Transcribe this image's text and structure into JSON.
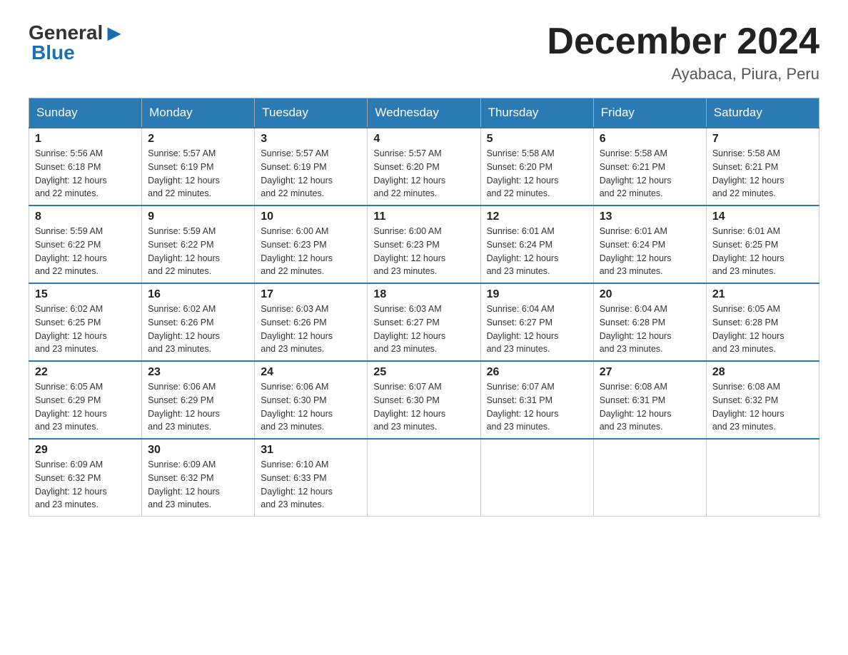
{
  "header": {
    "logo_general": "General",
    "logo_blue": "Blue",
    "title": "December 2024",
    "subtitle": "Ayabaca, Piura, Peru"
  },
  "days_of_week": [
    "Sunday",
    "Monday",
    "Tuesday",
    "Wednesday",
    "Thursday",
    "Friday",
    "Saturday"
  ],
  "weeks": [
    [
      {
        "day": "1",
        "sunrise": "5:56 AM",
        "sunset": "6:18 PM",
        "daylight": "12 hours and 22 minutes."
      },
      {
        "day": "2",
        "sunrise": "5:57 AM",
        "sunset": "6:19 PM",
        "daylight": "12 hours and 22 minutes."
      },
      {
        "day": "3",
        "sunrise": "5:57 AM",
        "sunset": "6:19 PM",
        "daylight": "12 hours and 22 minutes."
      },
      {
        "day": "4",
        "sunrise": "5:57 AM",
        "sunset": "6:20 PM",
        "daylight": "12 hours and 22 minutes."
      },
      {
        "day": "5",
        "sunrise": "5:58 AM",
        "sunset": "6:20 PM",
        "daylight": "12 hours and 22 minutes."
      },
      {
        "day": "6",
        "sunrise": "5:58 AM",
        "sunset": "6:21 PM",
        "daylight": "12 hours and 22 minutes."
      },
      {
        "day": "7",
        "sunrise": "5:58 AM",
        "sunset": "6:21 PM",
        "daylight": "12 hours and 22 minutes."
      }
    ],
    [
      {
        "day": "8",
        "sunrise": "5:59 AM",
        "sunset": "6:22 PM",
        "daylight": "12 hours and 22 minutes."
      },
      {
        "day": "9",
        "sunrise": "5:59 AM",
        "sunset": "6:22 PM",
        "daylight": "12 hours and 22 minutes."
      },
      {
        "day": "10",
        "sunrise": "6:00 AM",
        "sunset": "6:23 PM",
        "daylight": "12 hours and 22 minutes."
      },
      {
        "day": "11",
        "sunrise": "6:00 AM",
        "sunset": "6:23 PM",
        "daylight": "12 hours and 23 minutes."
      },
      {
        "day": "12",
        "sunrise": "6:01 AM",
        "sunset": "6:24 PM",
        "daylight": "12 hours and 23 minutes."
      },
      {
        "day": "13",
        "sunrise": "6:01 AM",
        "sunset": "6:24 PM",
        "daylight": "12 hours and 23 minutes."
      },
      {
        "day": "14",
        "sunrise": "6:01 AM",
        "sunset": "6:25 PM",
        "daylight": "12 hours and 23 minutes."
      }
    ],
    [
      {
        "day": "15",
        "sunrise": "6:02 AM",
        "sunset": "6:25 PM",
        "daylight": "12 hours and 23 minutes."
      },
      {
        "day": "16",
        "sunrise": "6:02 AM",
        "sunset": "6:26 PM",
        "daylight": "12 hours and 23 minutes."
      },
      {
        "day": "17",
        "sunrise": "6:03 AM",
        "sunset": "6:26 PM",
        "daylight": "12 hours and 23 minutes."
      },
      {
        "day": "18",
        "sunrise": "6:03 AM",
        "sunset": "6:27 PM",
        "daylight": "12 hours and 23 minutes."
      },
      {
        "day": "19",
        "sunrise": "6:04 AM",
        "sunset": "6:27 PM",
        "daylight": "12 hours and 23 minutes."
      },
      {
        "day": "20",
        "sunrise": "6:04 AM",
        "sunset": "6:28 PM",
        "daylight": "12 hours and 23 minutes."
      },
      {
        "day": "21",
        "sunrise": "6:05 AM",
        "sunset": "6:28 PM",
        "daylight": "12 hours and 23 minutes."
      }
    ],
    [
      {
        "day": "22",
        "sunrise": "6:05 AM",
        "sunset": "6:29 PM",
        "daylight": "12 hours and 23 minutes."
      },
      {
        "day": "23",
        "sunrise": "6:06 AM",
        "sunset": "6:29 PM",
        "daylight": "12 hours and 23 minutes."
      },
      {
        "day": "24",
        "sunrise": "6:06 AM",
        "sunset": "6:30 PM",
        "daylight": "12 hours and 23 minutes."
      },
      {
        "day": "25",
        "sunrise": "6:07 AM",
        "sunset": "6:30 PM",
        "daylight": "12 hours and 23 minutes."
      },
      {
        "day": "26",
        "sunrise": "6:07 AM",
        "sunset": "6:31 PM",
        "daylight": "12 hours and 23 minutes."
      },
      {
        "day": "27",
        "sunrise": "6:08 AM",
        "sunset": "6:31 PM",
        "daylight": "12 hours and 23 minutes."
      },
      {
        "day": "28",
        "sunrise": "6:08 AM",
        "sunset": "6:32 PM",
        "daylight": "12 hours and 23 minutes."
      }
    ],
    [
      {
        "day": "29",
        "sunrise": "6:09 AM",
        "sunset": "6:32 PM",
        "daylight": "12 hours and 23 minutes."
      },
      {
        "day": "30",
        "sunrise": "6:09 AM",
        "sunset": "6:32 PM",
        "daylight": "12 hours and 23 minutes."
      },
      {
        "day": "31",
        "sunrise": "6:10 AM",
        "sunset": "6:33 PM",
        "daylight": "12 hours and 23 minutes."
      },
      null,
      null,
      null,
      null
    ]
  ],
  "labels": {
    "sunrise": "Sunrise:",
    "sunset": "Sunset:",
    "daylight": "Daylight:"
  }
}
